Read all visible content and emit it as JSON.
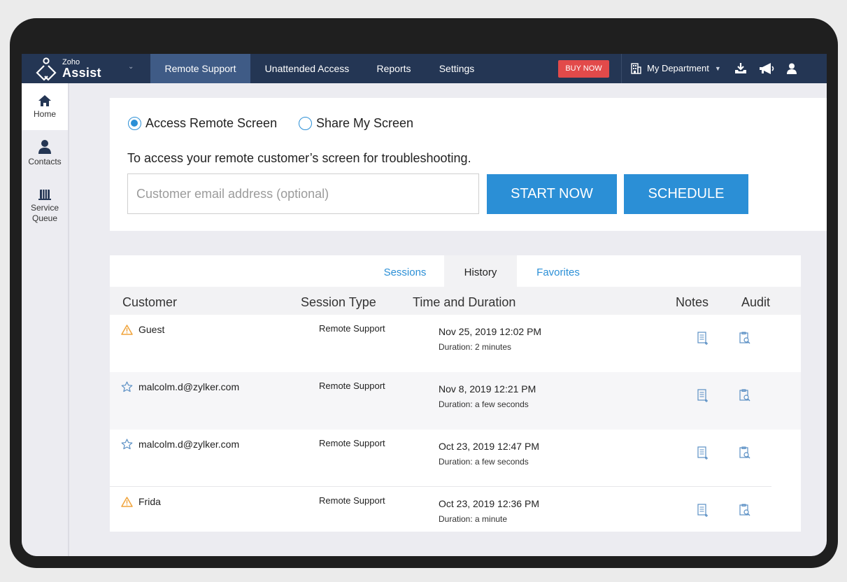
{
  "app": {
    "brand_small": "Zoho",
    "brand_large": "Assist"
  },
  "nav": {
    "items": [
      "Remote Support",
      "Unattended Access",
      "Reports",
      "Settings"
    ],
    "active": "Remote Support",
    "buy_now": "BUY NOW",
    "department": "My Department",
    "icons": [
      "download-icon",
      "announcement-icon",
      "user-profile-icon"
    ]
  },
  "sidebar": {
    "items": [
      {
        "label": "Home",
        "icon": "home-icon",
        "active": true
      },
      {
        "label": "Contacts",
        "icon": "contacts-icon",
        "active": false
      },
      {
        "label_line1": "Service",
        "label_line2": "Queue",
        "icon": "service-queue-icon",
        "active": false
      }
    ]
  },
  "access": {
    "options": [
      "Access Remote Screen",
      "Share My Screen"
    ],
    "selected": "Access Remote Screen",
    "description": "To access your remote customer’s screen for troubleshooting.",
    "email_placeholder": "Customer email address (optional)",
    "start_label": "START NOW",
    "schedule_label": "SCHEDULE"
  },
  "history": {
    "tabs": [
      "Sessions",
      "History",
      "Favorites"
    ],
    "active_tab": "History",
    "columns": [
      "Customer",
      "Session Type",
      "Time and Duration",
      "Notes",
      "Audit"
    ],
    "rows": [
      {
        "customer": "Guest",
        "icon": "warning-icon",
        "session_type": "Remote Support",
        "time": "Nov 25, 2019 12:02 PM",
        "duration": "Duration: 2 minutes"
      },
      {
        "customer": "malcolm.d@zylker.com",
        "icon": "star-icon",
        "session_type": "Remote Support",
        "time": "Nov 8, 2019 12:21 PM",
        "duration": "Duration: a few seconds"
      },
      {
        "customer": "malcolm.d@zylker.com",
        "icon": "star-icon",
        "session_type": "Remote Support",
        "time": "Oct 23, 2019 12:47 PM",
        "duration": "Duration: a few seconds"
      },
      {
        "customer": "Frida",
        "icon": "warning-icon",
        "session_type": "Remote Support",
        "time": "Oct 23, 2019 12:36 PM",
        "duration": "Duration: a minute"
      }
    ]
  },
  "colors": {
    "nav_bg": "#243654",
    "nav_active": "#3f5b86",
    "accent": "#2b8fd6",
    "buy_now": "#e24a4a",
    "warning": "#f0a33a"
  }
}
